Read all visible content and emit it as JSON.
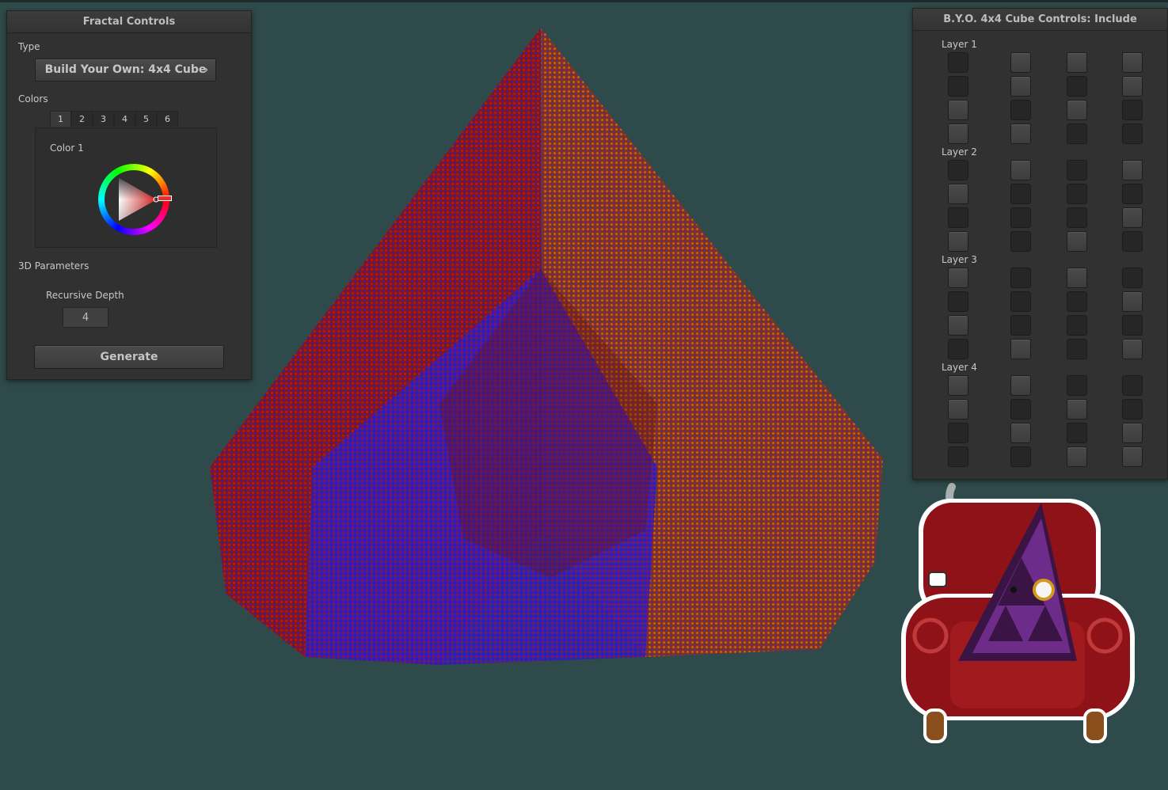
{
  "fractal_controls": {
    "title": "Fractal Controls",
    "type_label": "Type",
    "type_value": "Build Your Own: 4x4 Cube",
    "type_chevron": "›",
    "colors_label": "Colors",
    "color_tabs": [
      "1",
      "2",
      "3",
      "4",
      "5",
      "6"
    ],
    "active_color_tab": "1",
    "color_label": "Color 1",
    "selected_color": "#e63030",
    "params_label": "3D Parameters",
    "depth_label": "Recursive Depth",
    "depth_value": "4",
    "generate_label": "Generate"
  },
  "cube_controls": {
    "title": "B.Y.O. 4x4 Cube Controls: Include",
    "layers": [
      {
        "label": "Layer 1",
        "cells": [
          0,
          1,
          1,
          1,
          0,
          1,
          0,
          1,
          1,
          0,
          1,
          0,
          1,
          1,
          0,
          0
        ]
      },
      {
        "label": "Layer 2",
        "cells": [
          0,
          1,
          0,
          1,
          1,
          0,
          0,
          0,
          0,
          0,
          0,
          1,
          1,
          0,
          1,
          0
        ]
      },
      {
        "label": "Layer 3",
        "cells": [
          1,
          0,
          1,
          0,
          0,
          0,
          0,
          1,
          1,
          0,
          0,
          0,
          0,
          1,
          0,
          1
        ]
      },
      {
        "label": "Layer 4",
        "cells": [
          1,
          1,
          0,
          0,
          1,
          0,
          1,
          0,
          0,
          1,
          0,
          1,
          0,
          0,
          1,
          1
        ]
      }
    ]
  },
  "colors": {
    "background": "#2f4a4a",
    "fractal_red": "#b5201e",
    "fractal_blue": "#2222d6",
    "fractal_orange": "#c06a1a"
  },
  "icons": {
    "dropdown": "chevron-right-icon",
    "color_picker": "color-wheel-icon",
    "mascot": "sierpinski-triangle-armchair-mascot"
  }
}
